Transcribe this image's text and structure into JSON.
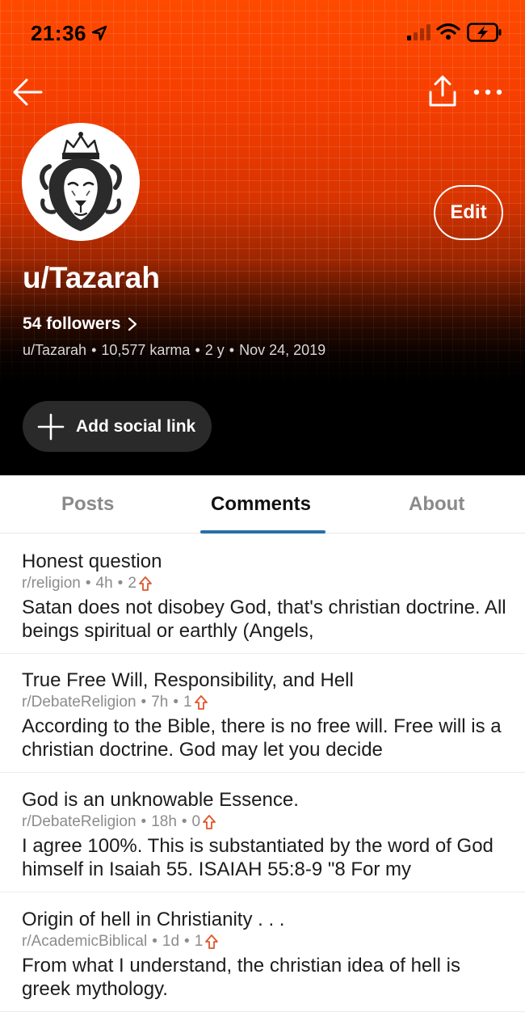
{
  "status_bar": {
    "time": "21:36"
  },
  "profile": {
    "username": "u/Tazarah",
    "followers": "54 followers",
    "handle": "u/Tazarah",
    "karma": "10,577 karma",
    "age": "2 y",
    "joined": "Nov 24, 2019",
    "edit_label": "Edit",
    "social_label": "Add social link"
  },
  "tabs": [
    {
      "label": "Posts"
    },
    {
      "label": "Comments"
    },
    {
      "label": "About"
    }
  ],
  "comments": [
    {
      "title": "Honest question",
      "subreddit": "r/religion",
      "age": "4h",
      "score": "2",
      "body": "Satan does not disobey God, that's christian doctrine. All beings spiritual or earthly (Angels,"
    },
    {
      "title": "True Free Will, Responsibility, and Hell",
      "subreddit": "r/DebateReligion",
      "age": "7h",
      "score": "1",
      "body": "According to the Bible, there is no free will. Free will is a christian doctrine. God may let you decide"
    },
    {
      "title": "God is an unknowable Essence.",
      "subreddit": "r/DebateReligion",
      "age": "18h",
      "score": "0",
      "body": "I agree 100%. This is substantiated by the word of God himself in Isaiah 55. ISAIAH 55:8-9 \"8 For my"
    },
    {
      "title": "Origin of hell in Christianity . . .",
      "subreddit": "r/AcademicBiblical",
      "age": "1d",
      "score": "1",
      "body": "From what I understand, the christian idea of hell is greek mythology."
    }
  ],
  "colors": {
    "accent_orange": "#ff4a00",
    "tab_underline": "#2a6fa8",
    "upvote": "#e0562b"
  },
  "icons": [
    "location-arrow-icon",
    "cellular-signal-icon",
    "wifi-icon",
    "battery-charging-icon",
    "back-arrow-icon",
    "share-icon",
    "more-icon",
    "chevron-right-icon",
    "plus-icon",
    "upvote-icon"
  ]
}
